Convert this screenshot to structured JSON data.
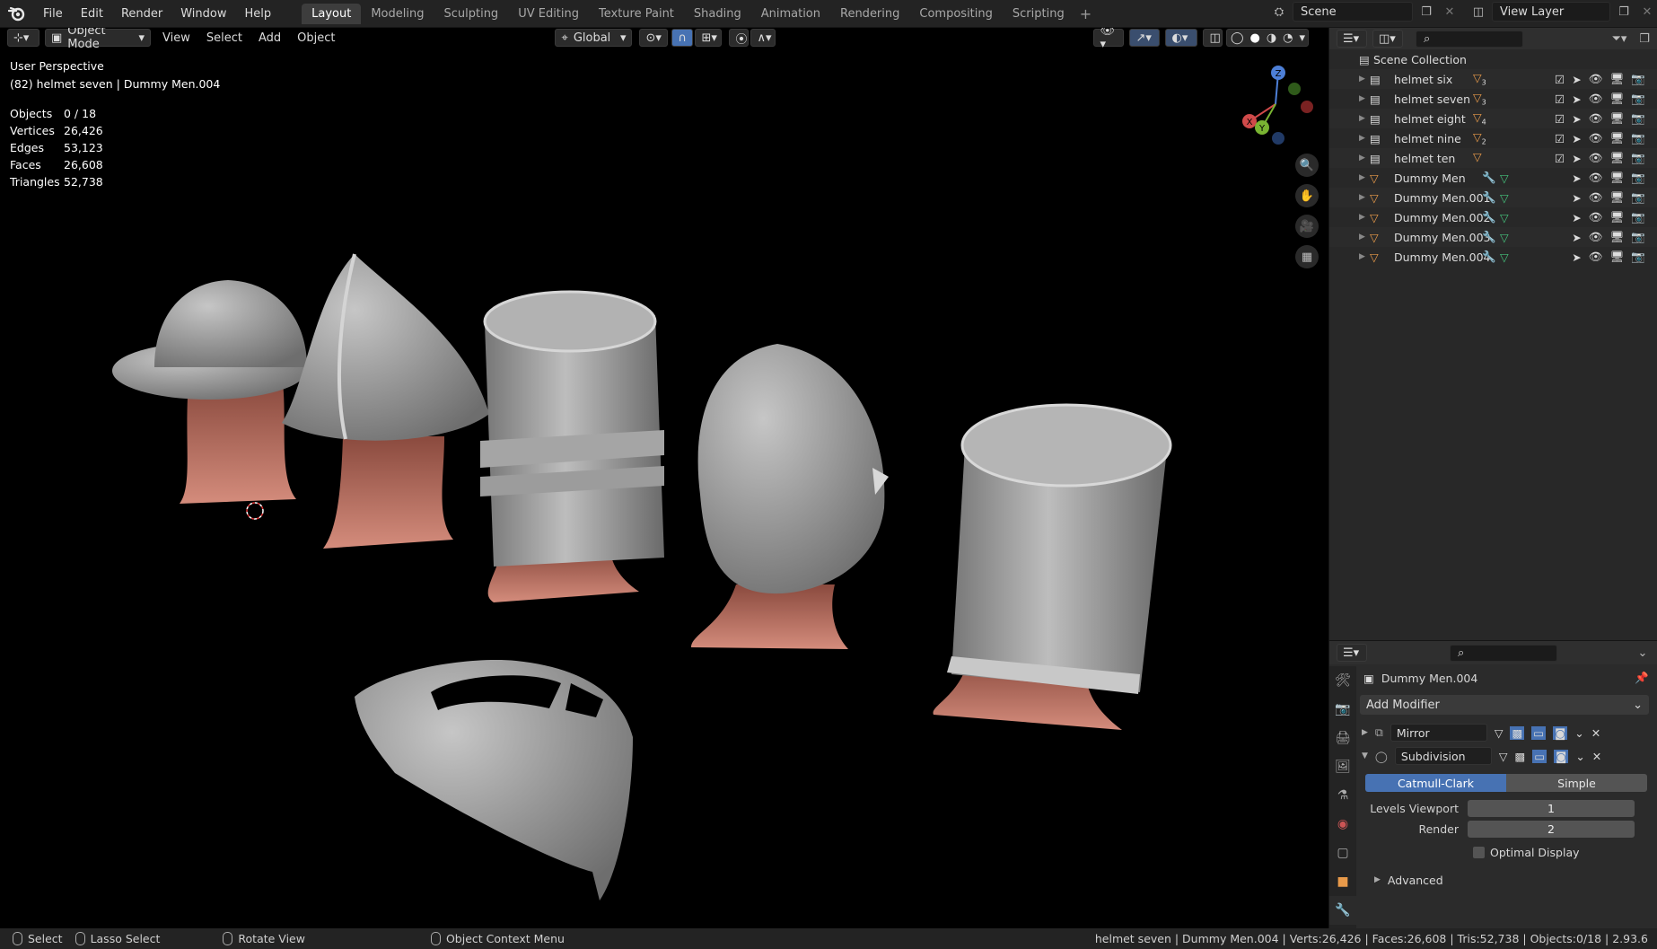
{
  "menu": [
    "File",
    "Edit",
    "Render",
    "Window",
    "Help"
  ],
  "workspaces": [
    "Layout",
    "Modeling",
    "Sculpting",
    "UV Editing",
    "Texture Paint",
    "Shading",
    "Animation",
    "Rendering",
    "Compositing",
    "Scripting"
  ],
  "active_workspace": "Layout",
  "scene_name": "Scene",
  "view_layer": "View Layer",
  "vp_header": {
    "mode": "Object Mode",
    "view": "View",
    "select": "Select",
    "add": "Add",
    "object": "Object",
    "orientation": "Global"
  },
  "overlay": {
    "perspective": "User Perspective",
    "context": "(82) helmet seven | Dummy Men.004",
    "stats": [
      {
        "k": "Objects",
        "v": "0 / 18"
      },
      {
        "k": "Vertices",
        "v": "26,426"
      },
      {
        "k": "Edges",
        "v": "53,123"
      },
      {
        "k": "Faces",
        "v": "26,608"
      },
      {
        "k": "Triangles",
        "v": "52,738"
      }
    ]
  },
  "gizmo": {
    "x": "X",
    "y": "Y",
    "z": "Z"
  },
  "outliner": {
    "root": "Scene Collection",
    "items": [
      {
        "name": "helmet six",
        "type": "collection",
        "badge": "3"
      },
      {
        "name": "helmet seven",
        "type": "collection",
        "badge": "3"
      },
      {
        "name": "helmet eight",
        "type": "collection",
        "badge": "4"
      },
      {
        "name": "helmet nine",
        "type": "collection",
        "badge": "2"
      },
      {
        "name": "helmet ten",
        "type": "collection",
        "badge": ""
      },
      {
        "name": "Dummy Men",
        "type": "mesh",
        "badge": ""
      },
      {
        "name": "Dummy Men.001",
        "type": "mesh",
        "badge": ""
      },
      {
        "name": "Dummy Men.002",
        "type": "mesh",
        "badge": ""
      },
      {
        "name": "Dummy Men.003",
        "type": "mesh",
        "badge": ""
      },
      {
        "name": "Dummy Men.004",
        "type": "mesh",
        "badge": ""
      }
    ]
  },
  "properties": {
    "object_name": "Dummy Men.004",
    "add_modifier": "Add Modifier",
    "modifiers": [
      {
        "name": "Mirror"
      },
      {
        "name": "Subdivision"
      }
    ],
    "subdiv_types": [
      "Catmull-Clark",
      "Simple"
    ],
    "levels_viewport_label": "Levels Viewport",
    "levels_viewport": "1",
    "render_label": "Render",
    "render_levels": "2",
    "optimal_display": "Optimal Display",
    "advanced": "Advanced"
  },
  "statusbar": {
    "select": "Select",
    "lasso": "Lasso Select",
    "rotate": "Rotate View",
    "context_menu": "Object Context Menu",
    "info": "helmet seven | Dummy Men.004 | Verts:26,426 | Faces:26,608 | Tris:52,738 | Objects:0/18 | 2.93.6"
  },
  "colors": {
    "accent": "#4772b3",
    "skin": "#c27a6c",
    "helmet": "#9a9a9a",
    "mesh_icon": "#e89a4a"
  }
}
